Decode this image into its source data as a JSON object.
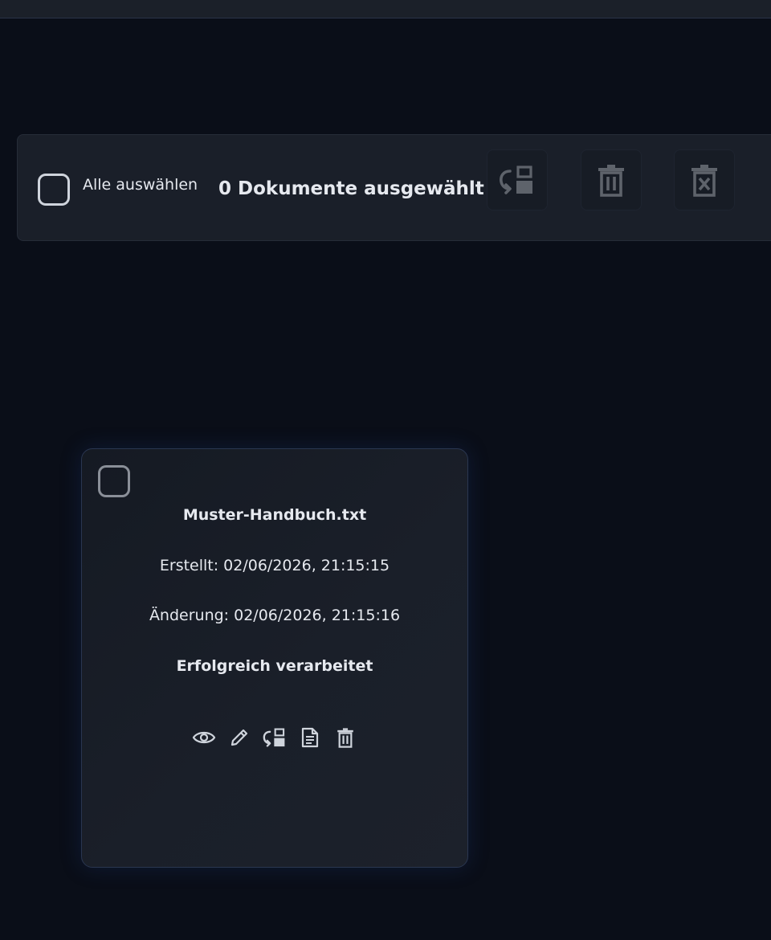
{
  "toolbar": {
    "select_all_label": "Alle auswählen",
    "selected_count_text": "0 Dokumente ausgewählt",
    "buttons": [
      {
        "icon": "reprocess-icon"
      },
      {
        "icon": "trash-icon"
      },
      {
        "icon": "trash-x-icon"
      }
    ]
  },
  "document": {
    "filename": "Muster-Handbuch.txt",
    "created": "Erstellt: 02/06/2026, 21:15:15",
    "modified": "Änderung: 02/06/2026, 21:15:16",
    "status": "Erfolgreich verarbeitet",
    "actions": [
      {
        "icon": "eye-icon"
      },
      {
        "icon": "pencil-icon"
      },
      {
        "icon": "reprocess-icon"
      },
      {
        "icon": "document-text-icon"
      },
      {
        "icon": "trash-icon"
      }
    ]
  },
  "colors": {
    "background": "#0a0e18",
    "panel": "#1a1f29",
    "text": "#e6e9ef",
    "icon_disabled": "#5e636b",
    "icon_active": "#cfd4dc"
  }
}
